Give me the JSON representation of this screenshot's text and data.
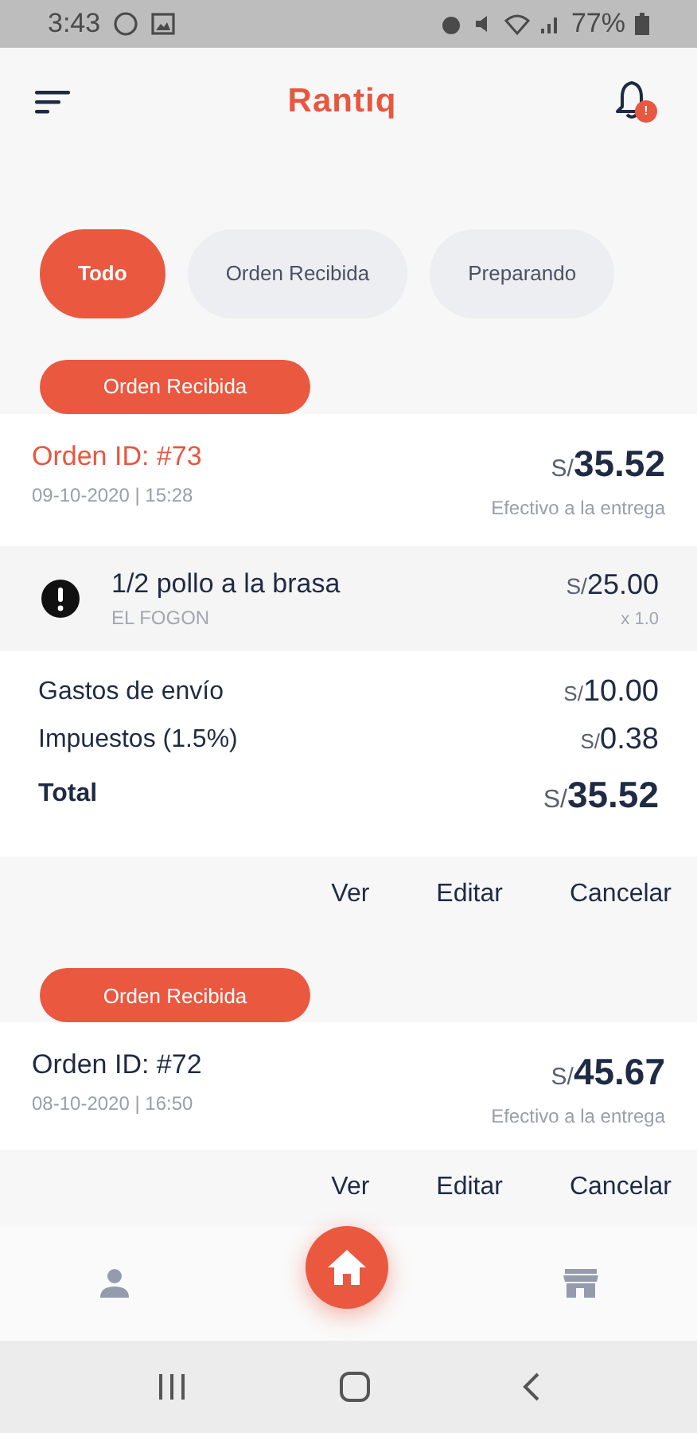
{
  "status_bar": {
    "time": "3:43",
    "battery": "77%"
  },
  "app_bar": {
    "title": "Rantiq",
    "notification_badge": "!"
  },
  "filters": [
    {
      "label": "Todo",
      "selected": true
    },
    {
      "label": "Orden Recibida",
      "selected": false
    },
    {
      "label": "Preparando",
      "selected": false
    }
  ],
  "orders": [
    {
      "status": "Orden Recibida",
      "order_id": "Orden ID: #73",
      "highlighted": true,
      "date": "09-10-2020 | 15:28",
      "currency": "S/",
      "amount": "35.52",
      "payment": "Efectivo a la entrega",
      "items": [
        {
          "name": "1/2 pollo a la brasa",
          "store": "EL FOGON",
          "currency": "S/",
          "price": "25.00",
          "quantity": "x 1.0"
        }
      ],
      "totals": [
        {
          "kind": "line",
          "label": "Gastos de envío",
          "currency": "S/",
          "value": "10.00"
        },
        {
          "kind": "line",
          "label": "Impuestos (1.5%)",
          "currency": "S/",
          "value": "0.38"
        },
        {
          "kind": "total",
          "label": "Total",
          "currency": "S/",
          "value": "35.52"
        }
      ],
      "actions": [
        "Ver",
        "Editar",
        "Cancelar"
      ]
    },
    {
      "status": "Orden Recibida",
      "order_id": "Orden ID: #72",
      "highlighted": false,
      "date": "08-10-2020 | 16:50",
      "currency": "S/",
      "amount": "45.67",
      "payment": "Efectivo a la entrega",
      "actions": [
        "Ver",
        "Editar",
        "Cancelar"
      ]
    }
  ],
  "bottom_nav": [
    {
      "kind": "profile",
      "selected": false
    },
    {
      "kind": "home",
      "selected": true
    },
    {
      "kind": "store",
      "selected": false
    }
  ]
}
